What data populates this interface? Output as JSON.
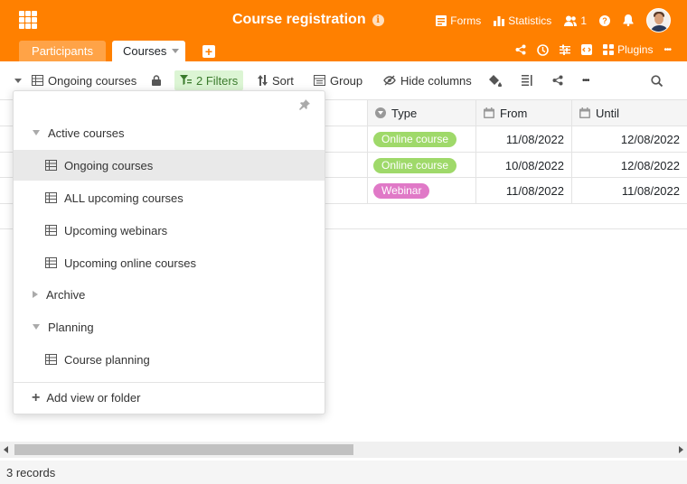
{
  "app": {
    "title": "Course registration",
    "info_symbol": "i"
  },
  "header": {
    "forms": "Forms",
    "statistics": "Statistics",
    "collaborators": "1",
    "help": "?"
  },
  "tabs": [
    {
      "label": "Participants"
    },
    {
      "label": "Courses"
    }
  ],
  "tab_tools": {
    "add": "+",
    "plugins": "Plugins",
    "more": "•••"
  },
  "toolbar": {
    "view_name": "Ongoing courses",
    "filters": "2 Filters",
    "sort": "Sort",
    "group": "Group",
    "hide_columns": "Hide columns",
    "more": "•••"
  },
  "columns": [
    {
      "label": "Type",
      "icon": "single-select-icon"
    },
    {
      "label": "From",
      "icon": "calendar-icon"
    },
    {
      "label": "Until",
      "icon": "calendar-icon"
    }
  ],
  "rows": [
    {
      "type": "Online course",
      "type_color": "#9fd96a",
      "from": "11/08/2022",
      "until": "12/08/2022"
    },
    {
      "type": "Online course",
      "type_color": "#9fd96a",
      "from": "10/08/2022",
      "until": "12/08/2022"
    },
    {
      "type": "Webinar",
      "type_color": "#e079c7",
      "from": "11/08/2022",
      "until": "11/08/2022"
    }
  ],
  "views_dropdown": {
    "items": [
      {
        "kind": "folder",
        "expanded": true,
        "label": "Active courses"
      },
      {
        "kind": "view",
        "label": "Ongoing courses",
        "active": true
      },
      {
        "kind": "view",
        "label": "ALL upcoming courses"
      },
      {
        "kind": "view",
        "label": "Upcoming webinars"
      },
      {
        "kind": "view",
        "label": "Upcoming online courses"
      },
      {
        "kind": "folder",
        "expanded": false,
        "label": "Archive"
      },
      {
        "kind": "folder",
        "expanded": true,
        "label": "Planning"
      },
      {
        "kind": "view",
        "label": "Course planning"
      }
    ],
    "add_label": "Add view or folder",
    "add_symbol": "+"
  },
  "footer": {
    "records": "3 records"
  },
  "colors": {
    "brand": "#ff8000",
    "filters_bg": "#dcf5d4",
    "active_row": "#e9e9e9"
  }
}
